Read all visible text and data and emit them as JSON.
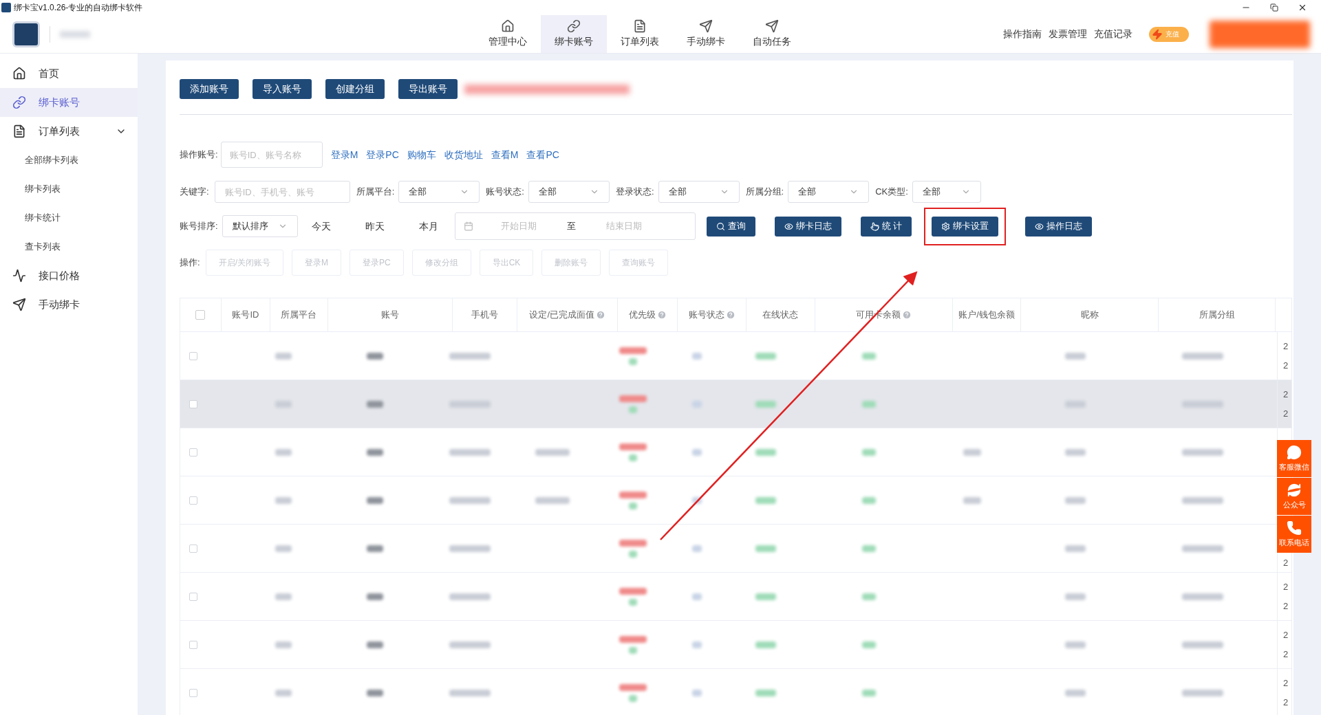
{
  "window": {
    "title": "绑卡宝v1.0.26-专业的自动绑卡软件"
  },
  "top_nav": {
    "items": [
      {
        "label": "管理中心",
        "selected": false
      },
      {
        "label": "绑卡账号",
        "selected": true
      },
      {
        "label": "订单列表",
        "selected": false
      },
      {
        "label": "手动绑卡",
        "selected": false
      },
      {
        "label": "自动任务",
        "selected": false
      }
    ]
  },
  "header_links": [
    "操作指南",
    "发票管理",
    "充值记录"
  ],
  "recharge_badge": "充值",
  "sidebar": {
    "items": [
      {
        "label": "首页",
        "selected": false
      },
      {
        "label": "绑卡账号",
        "selected": true
      },
      {
        "label": "订单列表",
        "selected": false,
        "expanded": true,
        "children": [
          {
            "label": "全部绑卡列表",
            "selected": false
          },
          {
            "label": "绑卡列表",
            "selected": false
          },
          {
            "label": "绑卡统计",
            "selected": false
          },
          {
            "label": "查卡列表",
            "selected": false
          }
        ]
      },
      {
        "label": "接口价格",
        "selected": false
      },
      {
        "label": "手动绑卡",
        "selected": false
      }
    ]
  },
  "action_buttons": [
    "添加账号",
    "导入账号",
    "创建分组",
    "导出账号"
  ],
  "operate_account": {
    "label": "操作账号:",
    "placeholder": "账号ID、账号名称",
    "links": [
      "登录M",
      "登录PC",
      "购物车",
      "收货地址",
      "查看M",
      "查看PC"
    ]
  },
  "filters": {
    "keyword": {
      "label": "关键字:",
      "placeholder": "账号ID、手机号、账号"
    },
    "selects": [
      {
        "label": "所属平台:",
        "value": "全部"
      },
      {
        "label": "账号状态:",
        "value": "全部"
      },
      {
        "label": "登录状态:",
        "value": "全部"
      },
      {
        "label": "所属分组:",
        "value": "全部"
      },
      {
        "label": "CK类型:",
        "value": "全部"
      }
    ]
  },
  "sort": {
    "label": "账号排序:",
    "value": "默认排序"
  },
  "quick_dates": [
    "今天",
    "昨天",
    "本月"
  ],
  "date_range": {
    "start_placeholder": "开始日期",
    "separator": "至",
    "end_placeholder": "结束日期"
  },
  "query_buttons": [
    {
      "label": "查询",
      "highlighted": false
    },
    {
      "label": "绑卡日志",
      "highlighted": false
    },
    {
      "label": "统 计",
      "highlighted": false
    },
    {
      "label": "绑卡设置",
      "highlighted": true
    },
    {
      "label": "操作日志",
      "highlighted": false
    }
  ],
  "operations": {
    "label": "操作:",
    "buttons": [
      {
        "label": "开启/关闭账号",
        "disabled": true
      },
      {
        "label": "登录M",
        "disabled": true
      },
      {
        "label": "登录PC",
        "disabled": true
      },
      {
        "label": "修改分组",
        "disabled": true
      },
      {
        "label": "导出CK",
        "disabled": true
      },
      {
        "label": "删除账号",
        "disabled": true
      },
      {
        "label": "查询账号",
        "disabled": true
      }
    ]
  },
  "table": {
    "select_all_checked": false,
    "columns": [
      {
        "label": "账号ID",
        "help": false
      },
      {
        "label": "所属平台",
        "help": false
      },
      {
        "label": "账号",
        "help": false
      },
      {
        "label": "手机号",
        "help": false
      },
      {
        "label": "设定/已完成面值",
        "help": true
      },
      {
        "label": "优先级",
        "help": true
      },
      {
        "label": "账号状态",
        "help": true
      },
      {
        "label": "在线状态",
        "help": false
      },
      {
        "label": "可用卡余额",
        "help": true
      },
      {
        "label": "账户/钱包余额",
        "help": false
      },
      {
        "label": "昵称",
        "help": false
      },
      {
        "label": "所属分组",
        "help": false
      }
    ],
    "rows": [
      {
        "hovered": false,
        "column_14": [
          "2",
          "2"
        ]
      },
      {
        "hovered": true,
        "column_14": [
          "2",
          "2"
        ]
      },
      {
        "hovered": false,
        "column_14": []
      },
      {
        "hovered": false,
        "column_14": []
      },
      {
        "hovered": false,
        "column_14": [
          "2"
        ]
      },
      {
        "hovered": false,
        "column_14": [
          "2",
          "2"
        ]
      },
      {
        "hovered": false,
        "column_14": [
          "2",
          "2"
        ]
      },
      {
        "hovered": false,
        "column_14": [
          "2",
          "2"
        ]
      }
    ]
  },
  "float_buttons": [
    "客服微信",
    "公众号",
    "联系电话"
  ]
}
